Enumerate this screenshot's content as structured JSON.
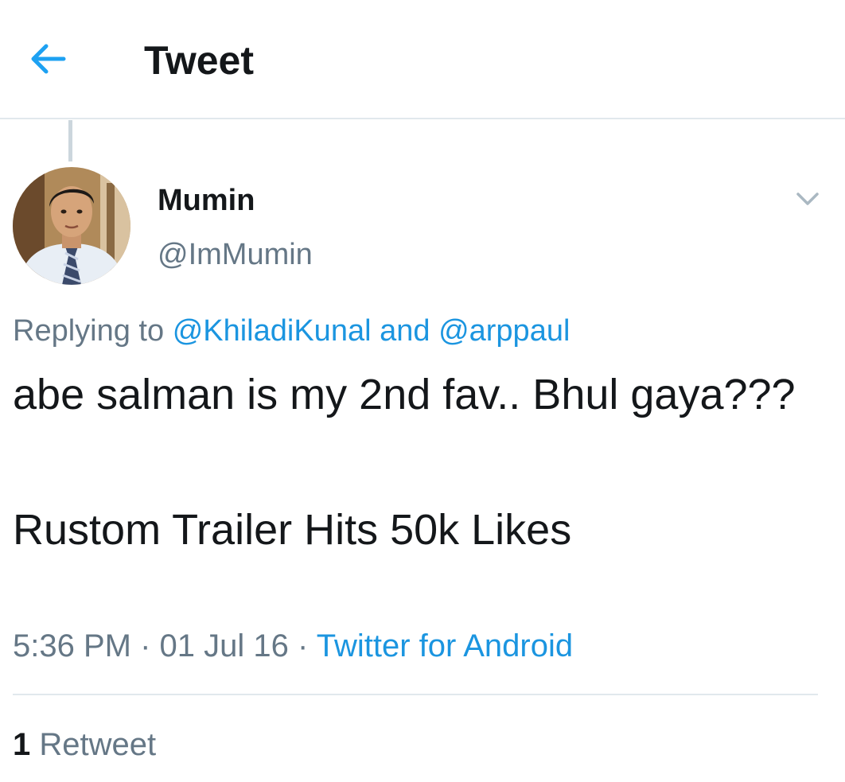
{
  "header": {
    "title": "Tweet",
    "back_icon": "arrow-left-icon",
    "accent_color": "#1da1f2"
  },
  "tweet": {
    "author": {
      "display_name": "Mumin",
      "handle": "@ImMumin",
      "avatar_icon": "user-avatar"
    },
    "menu_icon": "chevron-down-icon",
    "reply": {
      "prefix": "Replying to",
      "mention_1": "@KhiladiKunal",
      "conjunction": "and",
      "mention_2": "@arppaul"
    },
    "text_line_1": "abe salman is my 2nd fav.. Bhul gaya???",
    "text_line_2": "Rustom Trailer Hits 50k Likes",
    "meta": {
      "time": "5:36 PM",
      "separator": "·",
      "date": "01 Jul 16",
      "source": "Twitter for Android"
    },
    "stats": {
      "retweet_count": "1",
      "retweet_label": "Retweet"
    }
  },
  "colors": {
    "link": "#1b95e0",
    "secondary_text": "#657786",
    "primary_text": "#14171a",
    "divider": "#e1e8ed"
  }
}
